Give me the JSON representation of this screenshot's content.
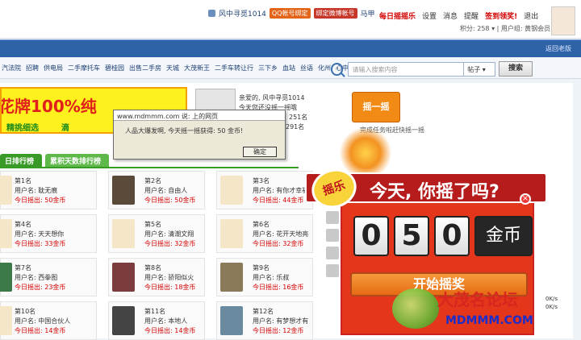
{
  "user_bar": {
    "username": "风中寻觅1014",
    "qq_badge": "QQ帐号绑定",
    "weibo_badge": "绑定微博帐号",
    "dropdown": "马甲"
  },
  "top_links": [
    "每日摇摇乐",
    "设置",
    "消息",
    "提醒",
    "签到领奖!",
    "退出"
  ],
  "score": {
    "label": "积分",
    "value": "258",
    "group_label": "用户组",
    "group": "黄钢会员"
  },
  "blue_bar_right": "返回老版",
  "nav_links": [
    "汽法院",
    "招聘",
    "供电局",
    "二手摩托车",
    "碧桂园",
    "出售二手房",
    "天城",
    "大茂新王",
    "二手车转让行",
    "三下乡",
    "血站",
    "丝语",
    "化州",
    "心中所爱"
  ],
  "search": {
    "placeholder": "请输入搜索内容",
    "scope": "帖子",
    "button": "搜索"
  },
  "banner": {
    "title": "花牌100%纯",
    "sub_left": "精挑细选",
    "sub_right": "滴"
  },
  "profile_text": {
    "greeting": "亲爱的, 风中寻觅1014",
    "line2": "今天您还没摇一摇哦",
    "line3": "251名",
    "line4": "291名"
  },
  "shake_button": {
    "label": "摇一摇",
    "sub": "完成任务啦赶快摇一摇"
  },
  "dialog": {
    "title": "www.mdmmm.com 说: 上的网页",
    "message": "人品大爆发啊, 今天摇一摇获得: 50 金币!",
    "ok": "确定"
  },
  "tabs": [
    "日排行榜",
    "累积天数排行榜"
  ],
  "ranking": [
    {
      "rank": "第1名",
      "user": "用户名: 耽无痕",
      "today": "今日摇出: 50金币"
    },
    {
      "rank": "第2名",
      "user": "用户名: 自由人",
      "today": "今日摇出: 50金币"
    },
    {
      "rank": "第3名",
      "user": "用户名: 有你才幸福",
      "today": "今日摇出: 44金币"
    },
    {
      "rank": "第4名",
      "user": "用户名: 天天想你",
      "today": "今日摇出: 33金币"
    },
    {
      "rank": "第5名",
      "user": "用户名: 清潮文翔",
      "today": "今日摇出: 32金币"
    },
    {
      "rank": "第6名",
      "user": "用户名: 花开天地亮",
      "today": "今日摇出: 32金币"
    },
    {
      "rank": "第7名",
      "user": "用户名: 西拳图",
      "today": "今日摇出: 23金币"
    },
    {
      "rank": "第8名",
      "user": "用户名: 骄阳似火",
      "today": "今日摇出: 18金币"
    },
    {
      "rank": "第9名",
      "user": "用户名: 乐叔",
      "today": "今日摇出: 16金币"
    },
    {
      "rank": "第10名",
      "user": "用户名: 中国合伙人",
      "today": "今日摇出: 14金币"
    },
    {
      "rank": "第11名",
      "user": "用户名: 本地人",
      "today": "今日摇出: 14金币"
    },
    {
      "rank": "第12名",
      "user": "用户名: 有梦想才有",
      "today": "今日摇出: 12金币"
    }
  ],
  "popup": {
    "badge": "摇乐",
    "title": "今天, 你摇了吗?",
    "digits": [
      "0",
      "5",
      "0"
    ],
    "unit": "金币",
    "start": "开始摇奖"
  },
  "watermark": {
    "name": "大茂名论坛",
    "url": "MDMMM.COM"
  },
  "mini_stats": [
    "0K/s",
    "0K/s"
  ]
}
